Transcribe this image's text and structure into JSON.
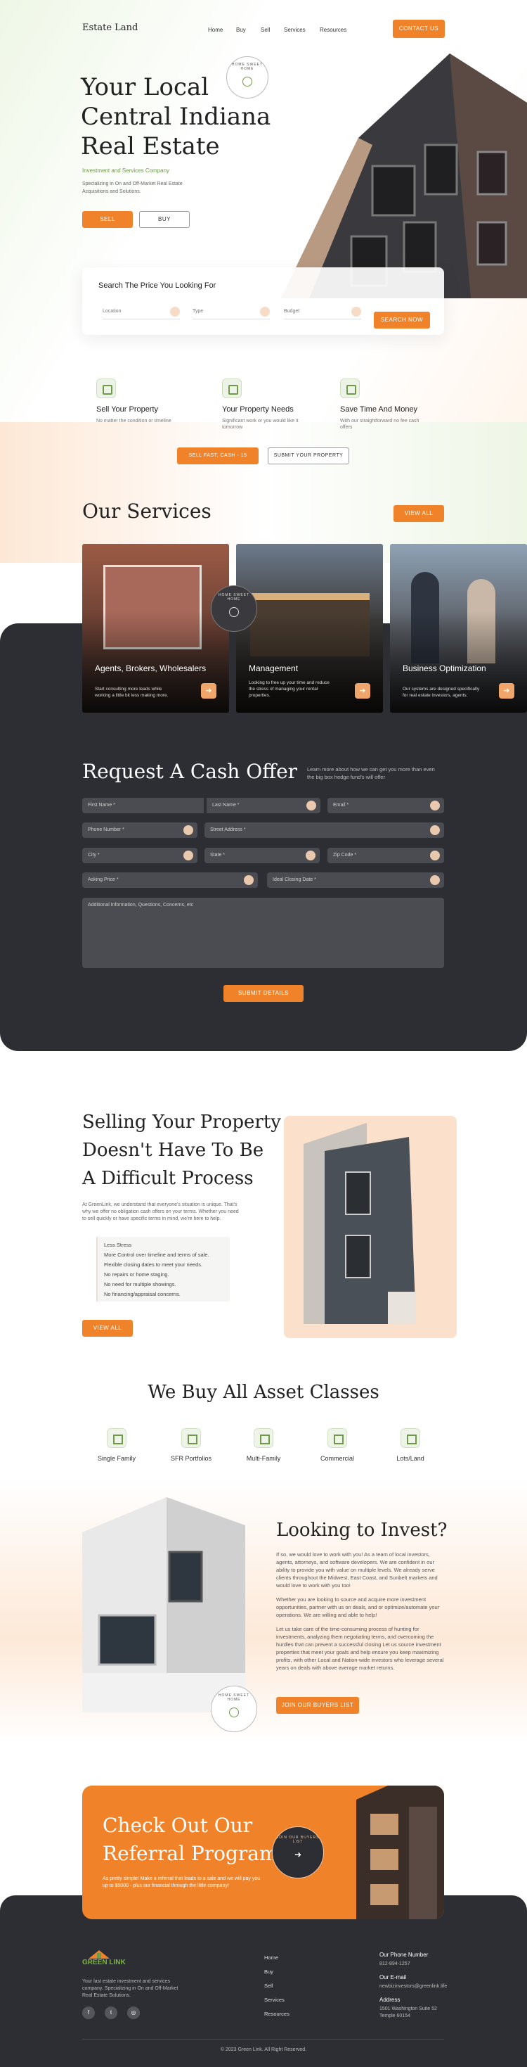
{
  "header": {
    "logo": "Estate Land",
    "nav": [
      "Home",
      "Buy",
      "Sell",
      "Services",
      "Resources"
    ],
    "cta": "CONTACT US"
  },
  "hero": {
    "title_line1": "Your Local",
    "title_line2": "Central Indiana",
    "title_line3": "Real Estate",
    "subtitle": "Investment and Services Company",
    "description": "Specializing in On and Off-Market Real Estate Acquisitions and Solutions.",
    "sell_label": "SELL",
    "buy_label": "BUY",
    "badge_text": "HOME SWEET HOME"
  },
  "search": {
    "title": "Search The Price You Looking For",
    "location": "Location",
    "type": "Type",
    "budget": "Budget",
    "button": "SEARCH NOW"
  },
  "features": [
    {
      "title": "Sell Your Property",
      "desc": "No matter the condition or timeline"
    },
    {
      "title": "Your Property Needs",
      "desc": "Significant work or you would like it tomorrow"
    },
    {
      "title": "Save Time And Money",
      "desc": "With our straightforward no fee cash offers"
    }
  ],
  "feature_buttons": {
    "sell_fast": "SELL FAST, CASH - 15",
    "submit": "SUBMIT YOUR PROPERTY"
  },
  "services": {
    "title": "Our Services",
    "view_all": "VIEW ALL",
    "badge_text": "HOME SWEET HOME",
    "cards": [
      {
        "title": "Agents, Brokers, Wholesalers",
        "desc": "Start consulting more leads while working a little bit less making more."
      },
      {
        "title": "Management",
        "desc": "Looking to free up your time and reduce the stress of managing your rental properties."
      },
      {
        "title": "Business Optimization",
        "desc": "Our systems are designed specifically for real estate investors, agents."
      }
    ]
  },
  "cash_offer": {
    "title": "Request A Cash Offer",
    "desc": "Learn more about how we can get you more than even the big box hedge fund's will offer",
    "fields": {
      "first_name": "First Name *",
      "last_name": "Last Name *",
      "email": "Email *",
      "phone": "Phone Number *",
      "street": "Street Address *",
      "city": "City *",
      "state": "State *",
      "zip": "Zip Code *",
      "asking": "Asking Price *",
      "closing": "Ideal Closing Date *",
      "info": "Additional Information, Questions, Concerns, etc"
    },
    "submit": "SUBMIT DETAILS"
  },
  "selling": {
    "title_line1": "Selling Your Property",
    "title_line2": "Doesn't Have To Be",
    "title_line3": "A Difficult Process",
    "description": "At GreenLink, we understand that everyone's situation is unique. That's why we offer no obligation cash offers on your terms. Whether you need to sell quickly or have specific terms in mind, we're here to help.",
    "bullets": [
      "Less Stress",
      "More Control over timeline and terms of sale.",
      "Flexible closing dates to meet your needs.",
      "No repairs or home staging.",
      "No need for multiple showings.",
      "No financing/appraisal concerns."
    ],
    "view_all": "VIEW ALL"
  },
  "assets": {
    "title": "We Buy All Asset Classes",
    "items": [
      "Single Family",
      "SFR Portfolios",
      "Multi-Family",
      "Commercial",
      "Lots/Land"
    ]
  },
  "invest": {
    "title": "Looking to Invest?",
    "para1": "If so, we would love to work with you! As a team of local investors, agents, attorneys, and software developers. We are confident in our ability to provide you with value on multiple levels. We already serve clients throughout the Midwest, East Coast, and Sunbelt markets and would love to work with you too!",
    "para2": "Whether you are looking to source and acquire more investment opportunities, partner with us on deals, and or optimize/automate your operations. We are willing and able to help!",
    "para3": "Let us take care of the time-consuming process of hunting for investments, analyzing them negotiating terms, and overcoming the hurdles that can prevent a successful closing Let us source investment properties that meet your goals and help ensure you keep maximizing profits, with other Local and Nation-wide investors who leverage several years on deals with above average market returns.",
    "button": "JOIN OUR BUYERS LIST",
    "badge_text": "HOME SWEET HOME"
  },
  "referral": {
    "title_line1": "Check Out Our",
    "title_line2": "Referral Program",
    "desc": "As pretty simple! Make a referral that leads to a sale and we will pay you up to $5000 - plus our financial through the little company!",
    "badge_text": "JOIN OUR BUYERS LIST"
  },
  "footer": {
    "brand": "GREEN LINK",
    "desc": "Your last estate investment and services company. Specializing in On and Off-Market Real Estate Solutions.",
    "links": [
      "Home",
      "Buy",
      "Sell",
      "Services",
      "Resources"
    ],
    "phone_label": "Our Phone Number",
    "phone": "812-894-1257",
    "email_label": "Our E-mail",
    "email": "newbizinvestors@greenlink.life",
    "address_label": "Address",
    "address_line1": "1501 Washington Suite 52",
    "address_line2": "Temple 60154",
    "copyright": "© 2023 Green Link. All Right Reserved."
  },
  "colors": {
    "accent": "#f0832a",
    "dark": "#2d2e33",
    "green": "#6e9a4a"
  }
}
